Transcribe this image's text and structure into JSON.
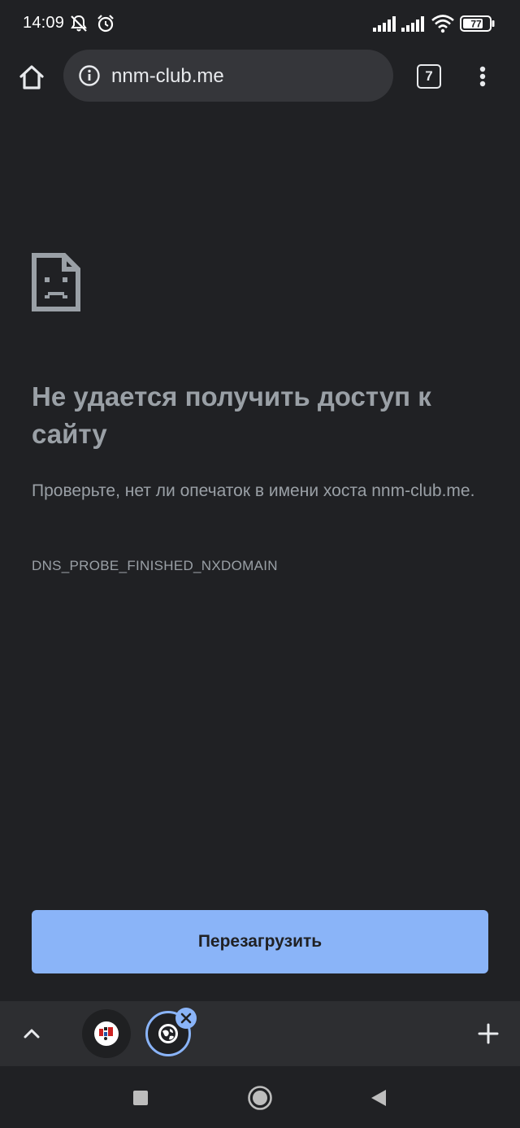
{
  "status_bar": {
    "time": "14:09",
    "battery_level": "77",
    "icons": [
      "muted-notification-icon",
      "alarm-icon",
      "signal-icon",
      "signal-icon",
      "wifi-icon",
      "battery-icon"
    ]
  },
  "toolbar": {
    "url": "nnm-club.me",
    "tab_count": "7",
    "icons": [
      "home-icon",
      "info-icon",
      "tab-switcher-icon",
      "more-vert-icon"
    ]
  },
  "error_page": {
    "icon": "sad-page-icon",
    "title": "Не удается получить доступ к сайту",
    "description": "Проверьте, нет ли опечаток в имени хоста nnm-club.me.",
    "error_code": "DNS_PROBE_FINISHED_NXDOMAIN",
    "reload_label": "Перезагрузить",
    "button_color": "#8ab4f8"
  },
  "tab_group_bar": {
    "icons": [
      "chevron-up-icon",
      "site-favicon",
      "globe-favicon",
      "close-icon",
      "plus-icon"
    ]
  },
  "nav_bar": {
    "icons": [
      "recents-icon",
      "home-nav-icon",
      "back-icon"
    ]
  },
  "colors": {
    "background": "#202124",
    "accent": "#8ab4f8",
    "secondary_text": "#9aa0a6",
    "omnibox": "#35363a"
  }
}
